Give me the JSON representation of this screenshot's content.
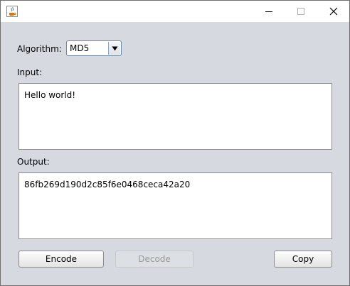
{
  "titlebar": {
    "app_icon": "java-icon",
    "minimize_icon": "minimize-icon",
    "maximize_icon": "maximize-icon",
    "close_icon": "close-icon"
  },
  "algorithm": {
    "label": "Algorithm:",
    "selected": "MD5"
  },
  "input": {
    "label": "Input:",
    "value": "Hello world!"
  },
  "output": {
    "label": "Output:",
    "value": "86fb269d190d2c85f6e0468ceca42a20"
  },
  "buttons": {
    "encode": "Encode",
    "decode": "Decode",
    "copy": "Copy",
    "decode_enabled": false
  },
  "colors": {
    "window_bg": "#d6d9df",
    "titlebar_bg": "#ffffff",
    "disabled_text": "#9a9a9a"
  }
}
